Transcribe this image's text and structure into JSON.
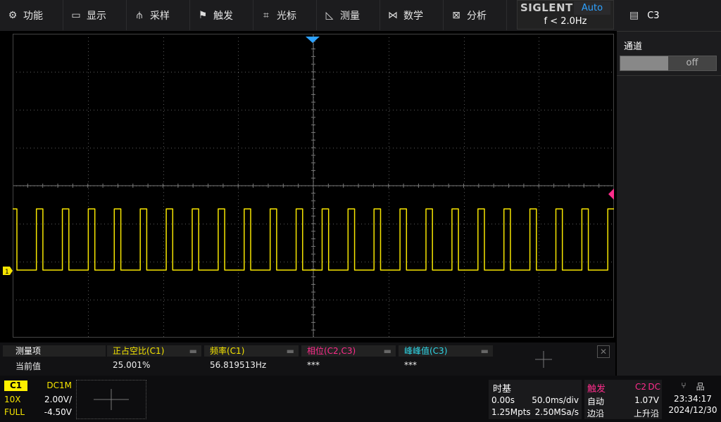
{
  "menu": [
    {
      "label": "功能",
      "icon": "gear-icon",
      "glyph": "⚙"
    },
    {
      "label": "显示",
      "icon": "monitor-icon",
      "glyph": "▭"
    },
    {
      "label": "采样",
      "icon": "sampling-icon",
      "glyph": "⫛"
    },
    {
      "label": "触发",
      "icon": "flag-icon",
      "glyph": "⚑"
    },
    {
      "label": "光标",
      "icon": "crosshair-icon",
      "glyph": "⌗"
    },
    {
      "label": "测量",
      "icon": "ruler-icon",
      "glyph": "◺"
    },
    {
      "label": "数学",
      "icon": "math-icon",
      "glyph": "⋈"
    },
    {
      "label": "分析",
      "icon": "analysis-icon",
      "glyph": "⊠"
    }
  ],
  "brand": {
    "name": "SIGLENT",
    "mode": "Auto",
    "freq": "f < 2.0Hz"
  },
  "right_panel": {
    "channel": "C3",
    "title": "通道",
    "toggle_value": "off"
  },
  "measurements": {
    "row_header": "测量项",
    "row_label": "当前值",
    "items": [
      {
        "name": "正占空比(C1)",
        "value": "25.001%",
        "color": "#f7e600"
      },
      {
        "name": "频率(C1)",
        "value": "56.819513Hz",
        "color": "#f7e600"
      },
      {
        "name": "相位(C2,C3)",
        "value": "***",
        "color": "#ff2d8c"
      },
      {
        "name": "峰峰值(C3)",
        "value": "***",
        "color": "#2fd8e8"
      }
    ]
  },
  "channel1": {
    "tag": "C1",
    "coupling": "DC1M",
    "probe": "10X",
    "scale": "2.00V/",
    "bw": "FULL",
    "offset": "-4.50V"
  },
  "timebase": {
    "title": "时基",
    "delay": "0.00s",
    "scale": "50.0ms/div",
    "memory": "1.25Mpts",
    "rate": "2.50MSa/s"
  },
  "trigger": {
    "title": "触发",
    "source": "C2",
    "coupling": "DC",
    "mode": "自动",
    "level": "1.07V",
    "type": "边沿",
    "slope": "上升沿"
  },
  "clock": {
    "time": "23:34:17",
    "date": "2024/12/30"
  },
  "colors": {
    "ch1": "#f7e600",
    "ch2": "#ff2d8c",
    "ch3": "#2fd8e8",
    "accent": "#2ea2ff",
    "grid": "#5a5a5a"
  },
  "waveform": {
    "channel": "C1",
    "duty_cycle": 0.25001,
    "frequency_hz": 56.819513,
    "pulse_count": 24
  }
}
